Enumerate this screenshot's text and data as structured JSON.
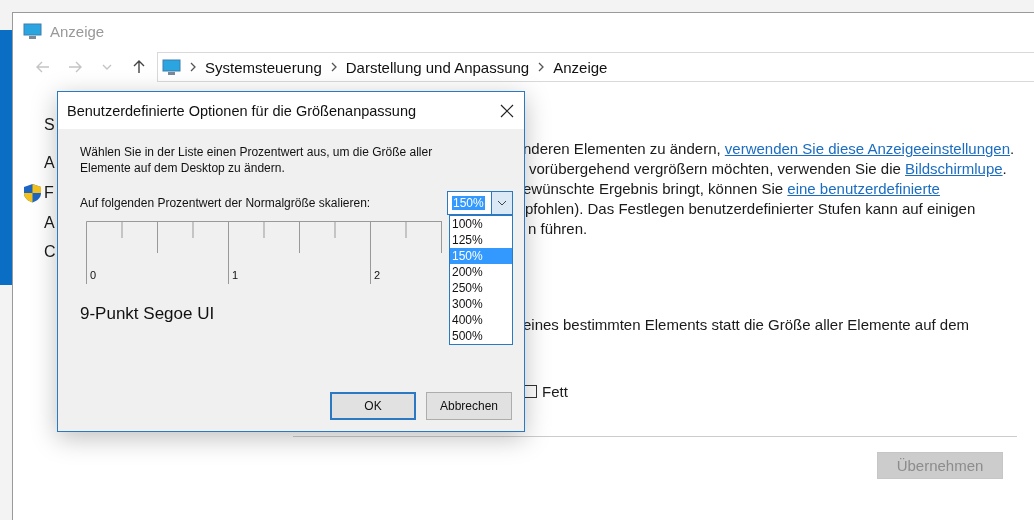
{
  "window": {
    "title": "Anzeige"
  },
  "navigation": {
    "breadcrumbs": [
      "Systemsteuerung",
      "Darstellung und Anpassung",
      "Anzeige"
    ]
  },
  "sidebar": {
    "items": [
      {
        "label": "S",
        "kind": "plain"
      },
      {
        "label": "A",
        "kind": "plain"
      },
      {
        "label": "F",
        "kind": "shield"
      },
      {
        "label": "A",
        "kind": "plain"
      },
      {
        "label": "C",
        "kind": "plain"
      }
    ]
  },
  "content": {
    "lines": [
      {
        "parts": [
          {
            "text": "nderen Elementen zu ändern, ",
            "link": false
          },
          {
            "text": "verwenden Sie diese Anzeigeeinstellungen",
            "link": true
          },
          {
            "text": ".",
            "link": false
          }
        ]
      },
      {
        "parts": [
          {
            "text": "vorübergehend vergrößern möchten, verwenden Sie die ",
            "link": false
          },
          {
            "text": "Bildschirmlupe",
            "link": true
          },
          {
            "text": ".",
            "link": false
          }
        ]
      },
      {
        "parts": [
          {
            "text": "ewünschte Ergebnis bringt, können Sie ",
            "link": false
          },
          {
            "text": "eine benutzerdefinierte",
            "link": true
          }
        ]
      },
      {
        "parts": [
          {
            "text": "pfohlen). Das Festlegen benutzerdefinierter Stufen kann auf einigen",
            "link": false
          }
        ]
      },
      {
        "parts": [
          {
            "text": "n führen.",
            "link": false
          }
        ]
      }
    ],
    "second_text": "eines bestimmten Elements statt die Größe aller Elemente auf dem",
    "bold_checkbox": {
      "label": "Fett",
      "checked": false
    },
    "apply_button": {
      "label": "Übernehmen",
      "disabled": true
    }
  },
  "dialog": {
    "title": "Benutzerdefinierte Optionen für die Größenanpassung",
    "description": "Wählen Sie in der Liste einen Prozentwert aus, um die Größe aller Elemente auf dem Desktop zu ändern.",
    "scale_label": "Auf folgenden Prozentwert der Normalgröße skalieren:",
    "scale_combo": {
      "value": "150%",
      "expanded": true,
      "options": [
        {
          "label": "100%",
          "selected": false
        },
        {
          "label": "125%",
          "selected": false
        },
        {
          "label": "150%",
          "selected": true
        },
        {
          "label": "200%",
          "selected": false
        },
        {
          "label": "250%",
          "selected": false
        },
        {
          "label": "300%",
          "selected": false
        },
        {
          "label": "400%",
          "selected": false
        },
        {
          "label": "500%",
          "selected": false
        }
      ]
    },
    "ruler": {
      "labels": [
        "0",
        "1",
        "2"
      ]
    },
    "sample_text": "9-Punkt Segoe UI",
    "buttons": [
      {
        "label": "OK",
        "default": true
      },
      {
        "label": "Abbrechen",
        "default": false
      }
    ]
  }
}
